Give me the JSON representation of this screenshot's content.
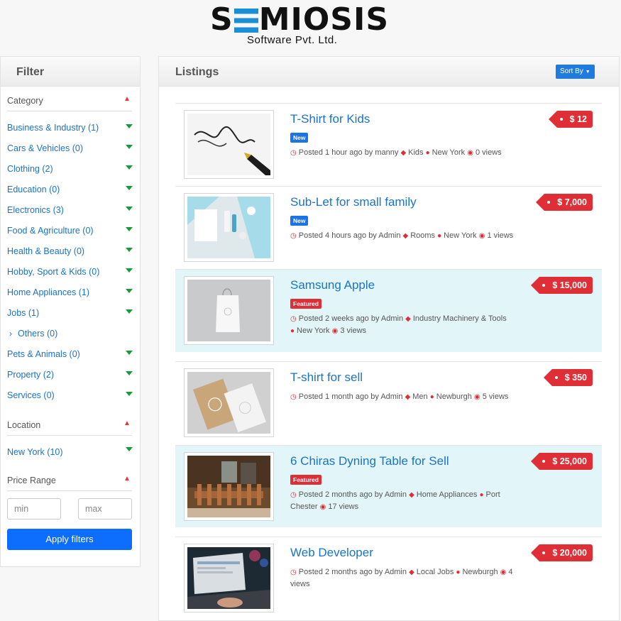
{
  "brand": {
    "name": "SEMIOSIS",
    "name_pre": "S",
    "name_post": "MIOSIS",
    "tagline": "Software Pvt. Ltd."
  },
  "sidebar": {
    "title": "Filter",
    "category_title": "Category",
    "categories": [
      {
        "label": "Business & Industry (1)"
      },
      {
        "label": "Cars & Vehicles (0)"
      },
      {
        "label": "Clothing (2)"
      },
      {
        "label": "Education (0)"
      },
      {
        "label": "Electronics (3)"
      },
      {
        "label": "Food & Agriculture (0)"
      },
      {
        "label": "Health & Beauty (0)"
      },
      {
        "label": "Hobby, Sport & Kids (0)"
      },
      {
        "label": "Home Appliances (1)"
      },
      {
        "label": "Jobs (1)"
      },
      {
        "label": "Others (0)"
      },
      {
        "label": "Pets & Animals (0)"
      },
      {
        "label": "Property (2)"
      },
      {
        "label": "Services (0)"
      }
    ],
    "location_title": "Location",
    "locations": [
      {
        "label": "New York (10)"
      }
    ],
    "price_title": "Price Range",
    "min_placeholder": "min",
    "max_placeholder": "max",
    "apply_label": "Apply filters"
  },
  "main": {
    "title": "Listings",
    "sort_label": "Sort By",
    "listings": [
      {
        "title": "T-Shirt for Kids",
        "badge": "New",
        "posted": "Posted 1 hour ago by manny",
        "category": "Kids",
        "location": "New York",
        "views": "0 views",
        "price": "$ 12"
      },
      {
        "title": "Sub-Let for small family",
        "badge": "New",
        "posted": "Posted 4 hours ago by Admin",
        "category": "Rooms",
        "location": "New York",
        "views": "1 views",
        "price": "$ 7,000"
      },
      {
        "title": "Samsung Apple",
        "badge": "Featured",
        "posted": "Posted 2 weeks ago by Admin",
        "category": "Industry Machinery & Tools",
        "location": "New York",
        "views": "3 views",
        "price": "$ 15,000"
      },
      {
        "title": "T-shirt for sell",
        "badge": "",
        "posted": "Posted 1 month ago by Admin",
        "category": "Men",
        "location": "Newburgh",
        "views": "5 views",
        "price": "$ 350"
      },
      {
        "title": "6 Chiras Dyning Table for Sell",
        "badge": "Featured",
        "posted": "Posted 2 months ago by Admin",
        "category": "Home Appliances",
        "location": "Port Chester",
        "views": "17 views",
        "price": "$ 25,000"
      },
      {
        "title": "Web Developer",
        "badge": "",
        "posted": "Posted 2 months ago by Admin",
        "category": "Local Jobs",
        "location": "Newburgh",
        "views": "4 views",
        "price": "$ 20,000"
      }
    ]
  },
  "colors": {
    "accent": "#1a73c7",
    "price": "#e02e36",
    "featured_bg": "#e2f5f8",
    "button": "#0d6efd"
  }
}
